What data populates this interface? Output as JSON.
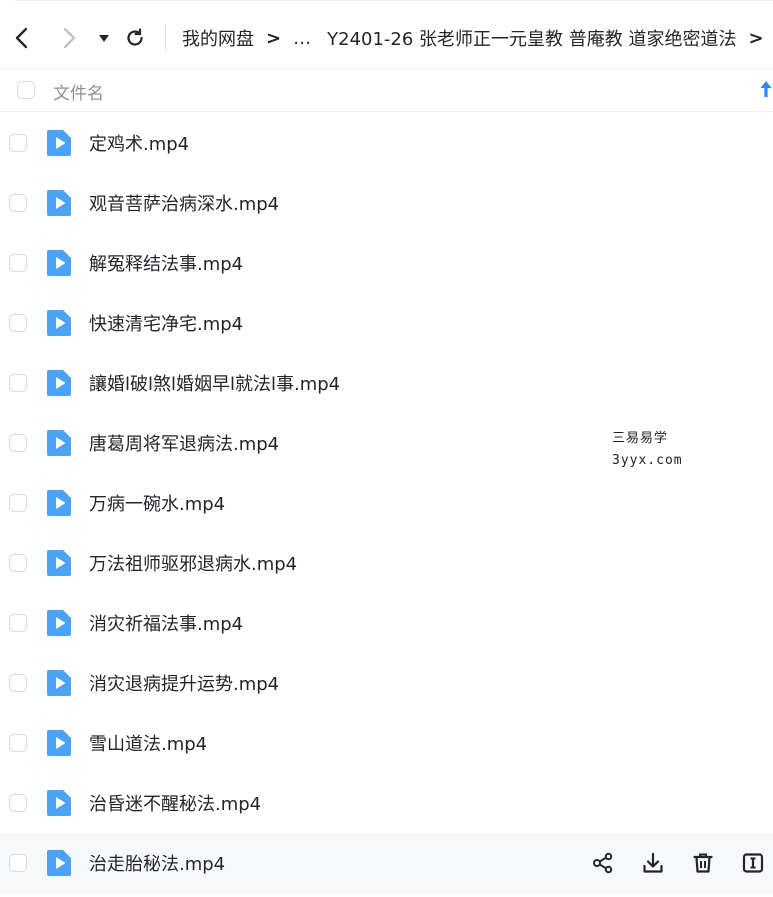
{
  "nav": {
    "breadcrumbs": [
      "我的网盘",
      "…",
      "Y2401-26 张老师正一元皇教 普庵教 道家绝密道法"
    ],
    "separator": ">"
  },
  "header": {
    "column_label": "文件名"
  },
  "files": [
    "定鸡术.mp4",
    "观音菩萨治病深水.mp4",
    "解冤释结法事.mp4",
    "快速清宅净宅.mp4",
    "讓婚l破l煞l婚姻早l就法l事.mp4",
    "唐葛周将军退病法.mp4",
    "万病一碗水.mp4",
    "万法祖师驱邪退病水.mp4",
    "消灾祈福法事.mp4",
    "消灾退病提升运势.mp4",
    "雪山道法.mp4",
    "治昏迷不醒秘法.mp4",
    "治走胎秘法.mp4"
  ],
  "watermark": {
    "line1": "三易易学",
    "line2": "3yyx.com"
  },
  "colors": {
    "file_icon": "#4aa3f7",
    "sort_arrow": "#2f88ff",
    "text": "#25262b",
    "muted": "#8a8f99"
  },
  "icons": {
    "row_actions": [
      "share-icon",
      "download-icon",
      "delete-icon",
      "rename-icon"
    ]
  }
}
